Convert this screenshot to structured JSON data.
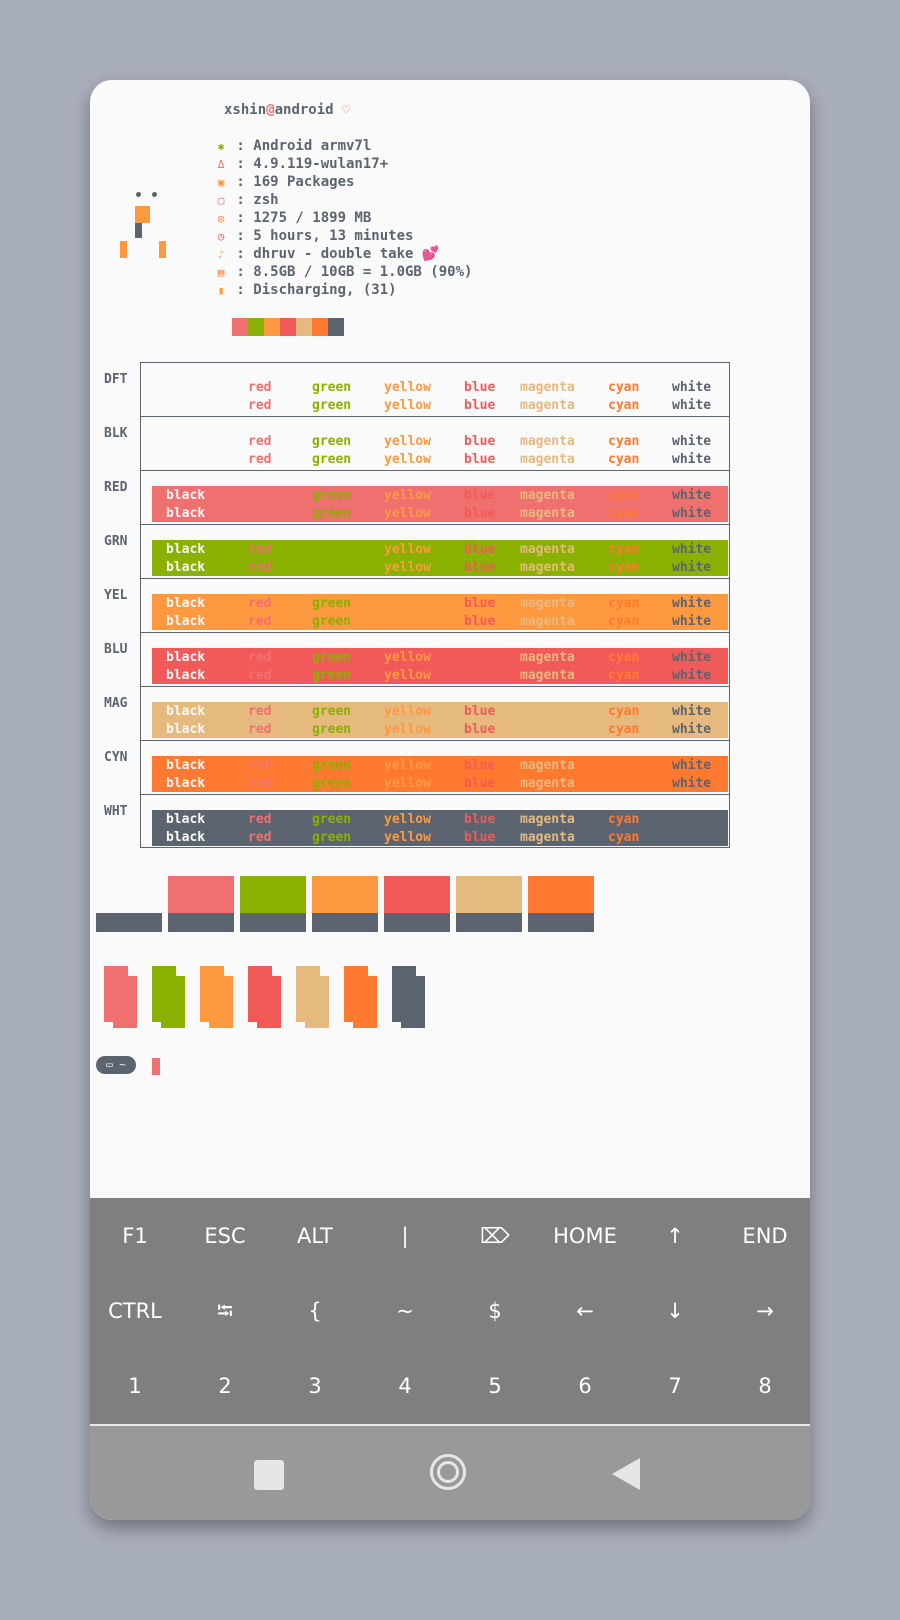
{
  "user": {
    "name": "xshin",
    "at": "@",
    "host": "android",
    "heart": "♡"
  },
  "info": [
    {
      "icon": "android-icon",
      "glyph": "✱",
      "color": "#8ab000",
      "text": ": Android armv7l"
    },
    {
      "icon": "kernel-icon",
      "glyph": "Δ",
      "color": "#f07070",
      "text": ": 4.9.119-wulan17+"
    },
    {
      "icon": "package-icon",
      "glyph": "▣",
      "color": "#ff9940",
      "text": ": 169 Packages"
    },
    {
      "icon": "shell-icon",
      "glyph": "▢",
      "color": "#f07070",
      "text": ": zsh"
    },
    {
      "icon": "memory-icon",
      "glyph": "◎",
      "color": "#ff7a30",
      "text": ": 1275 / 1899 MB"
    },
    {
      "icon": "uptime-icon",
      "glyph": "◷",
      "color": "#f25a5a",
      "text": ": 5 hours, 13 minutes"
    },
    {
      "icon": "music-icon",
      "glyph": "♪",
      "color": "#e6b97f",
      "text": ": dhruv - double take 💕"
    },
    {
      "icon": "storage-icon",
      "glyph": "▤",
      "color": "#ff7a30",
      "text": ": 8.5GB / 10GB = 1.0GB (90%)"
    },
    {
      "icon": "battery-icon",
      "glyph": "▮",
      "color": "#ff9940",
      "text": ": Discharging, (31)"
    }
  ],
  "colors": {
    "red": "#f07070",
    "green": "#8ab000",
    "yellow": "#ff9940",
    "blue": "#f25a5a",
    "magenta": "#e6b97f",
    "cyan": "#ff7a30",
    "white": "#5c6470",
    "bg": "#fafafa"
  },
  "palette": [
    "#f07070",
    "#8ab000",
    "#ff9940",
    "#f25a5a",
    "#e6b97f",
    "#ff7a30",
    "#5c6470"
  ],
  "table": {
    "column_names": [
      "black",
      "red",
      "green",
      "yellow",
      "blue",
      "magenta",
      "cyan",
      "white"
    ],
    "rows": [
      {
        "label": "DFT",
        "bg": null
      },
      {
        "label": "BLK",
        "bg": null
      },
      {
        "label": "RED",
        "bg": "#f07070"
      },
      {
        "label": "GRN",
        "bg": "#8ab000"
      },
      {
        "label": "YEL",
        "bg": "#ff9940"
      },
      {
        "label": "BLU",
        "bg": "#f25a5a"
      },
      {
        "label": "MAG",
        "bg": "#e6b97f"
      },
      {
        "label": "CYN",
        "bg": "#ff7a30"
      },
      {
        "label": "WHT",
        "bg": "#5c6470"
      }
    ]
  },
  "prompt": {
    "text": "▭ ~"
  },
  "keyboard": {
    "row1": [
      "F1",
      "ESC",
      "ALT",
      "|",
      "⌦",
      "HOME",
      "↑",
      "END"
    ],
    "row2": [
      "CTRL",
      "⭾",
      "{",
      "~",
      "$",
      "←",
      "↓",
      "→"
    ],
    "row3": [
      "1",
      "2",
      "3",
      "4",
      "5",
      "6",
      "7",
      "8"
    ]
  }
}
